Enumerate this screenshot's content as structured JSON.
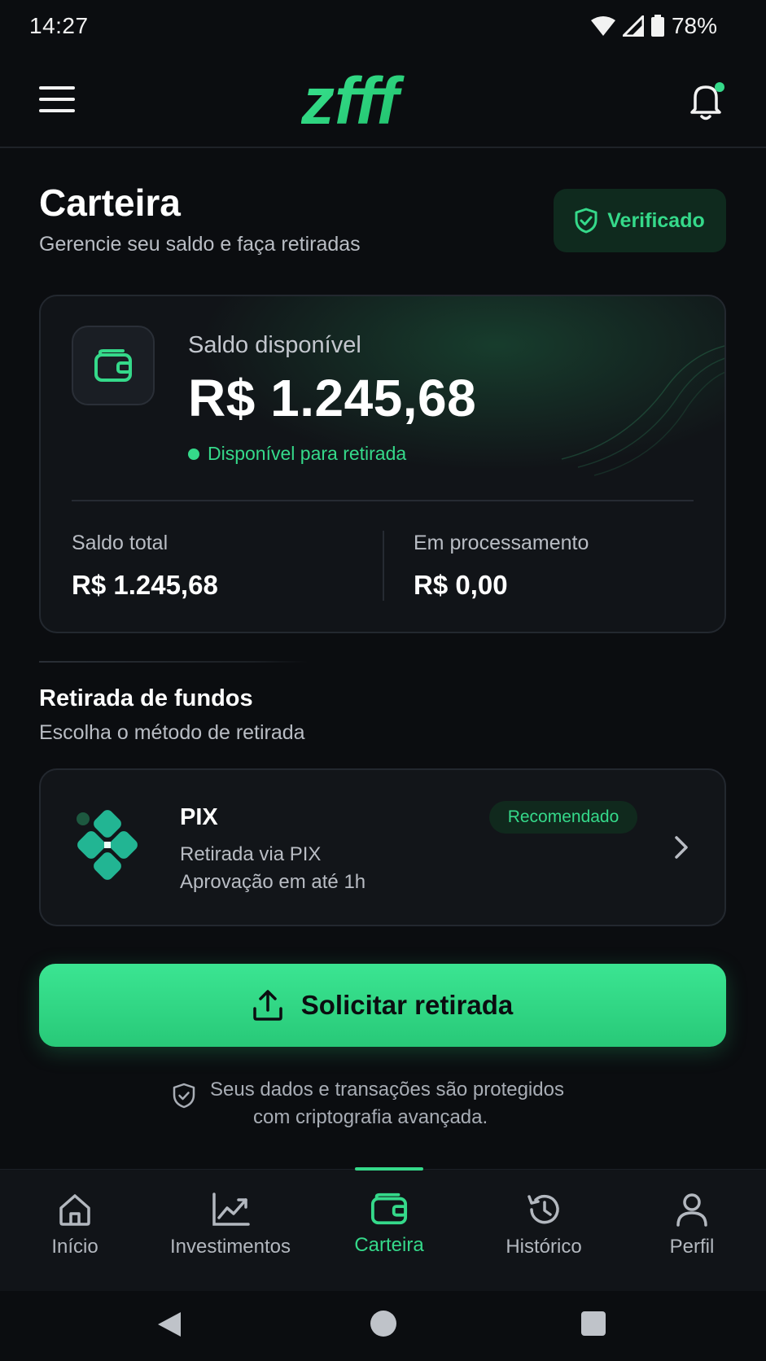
{
  "status_bar": {
    "time": "14:27",
    "battery": "78%"
  },
  "header": {
    "logo_text": "zfff",
    "icons": [
      "menu-icon",
      "bell-icon"
    ]
  },
  "page": {
    "title": "Carteira",
    "subtitle": "Gerencie seu saldo e faça retiradas",
    "verified_label": "Verificado"
  },
  "balance": {
    "available_label": "Saldo disponível",
    "available_value": "R$ 1.245,68",
    "available_status": "Disponível para retirada",
    "total_label": "Saldo total",
    "total_value": "R$ 1.245,68",
    "processing_label": "Em processamento",
    "processing_value": "R$ 0,00"
  },
  "withdraw": {
    "title": "Retirada de fundos",
    "subtitle": "Escolha o método de retirada",
    "method": {
      "name": "PIX",
      "badge": "Recomendado",
      "line1": "Retirada via PIX",
      "line2": "Aprovação em até 1h"
    },
    "cta_label": "Solicitar retirada",
    "security_line1": "Seus dados e transações são protegidos",
    "security_line2": "com criptografia avançada."
  },
  "bottom_nav": {
    "items": [
      {
        "label": "Início",
        "icon": "home-icon"
      },
      {
        "label": "Investimentos",
        "icon": "chart-icon"
      },
      {
        "label": "Carteira",
        "icon": "wallet-icon",
        "active": true
      },
      {
        "label": "Histórico",
        "icon": "history-icon"
      },
      {
        "label": "Perfil",
        "icon": "user-icon"
      }
    ]
  },
  "colors": {
    "accent": "#35d98a",
    "background": "#0b0d10",
    "card": "#111418"
  }
}
